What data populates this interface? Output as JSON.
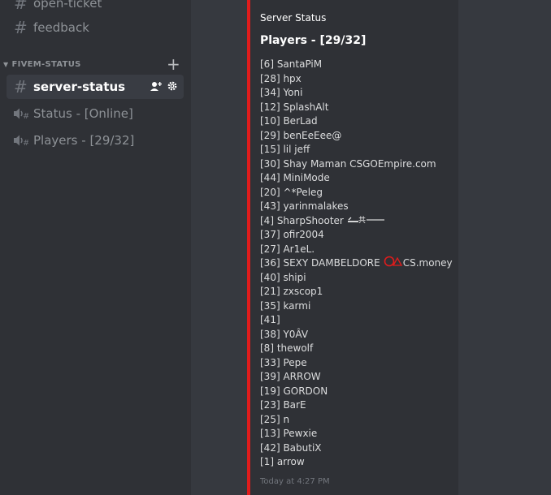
{
  "sidebar": {
    "channels_top": [
      {
        "label": "open-ticket"
      },
      {
        "label": "feedback"
      }
    ],
    "category": {
      "label": "FIVEM-STATUS"
    },
    "channels": [
      {
        "label": "server-status"
      },
      {
        "label": "Status - [Online]"
      },
      {
        "label": "Players - [29/32]"
      }
    ]
  },
  "embed": {
    "author": "Server Status",
    "title": "Players - [29/32]",
    "players": [
      "[6] SantaPiM",
      "[28] hpx",
      "[34] Yoni",
      "[12] SplashAlt",
      "[10] BerLad",
      "[29] benEeEee@",
      "[15] lil jeff",
      "[30] Shay Maman CSGOEmpire.com",
      "[44] MiniMode",
      "[20] ^*Peleg",
      "[43] yarinmalakes",
      "[4] SharpShooter",
      "[37] ofir2004",
      "[27] Ar1eL.",
      "[36] SEXY DAMBELDORE",
      "[40] shipi",
      "[21] zxscop1",
      "[35] karmi",
      "[41]",
      "[38] Y0ÂV",
      "[8] thewolf",
      "[33] Pepe",
      "[39] ARROW",
      "[19] GORDON",
      "[23] BarE",
      "[25] n",
      "[13] Pewxie",
      "[42] BabutiX",
      "[1] arrow"
    ],
    "player_suffix_36": "CS.money",
    "footer": "Today at 4:27 PM"
  },
  "colors": {
    "accent_bar": "#e01c1c",
    "sidebar_bg": "#2f3136",
    "chat_bg": "#36393f"
  }
}
